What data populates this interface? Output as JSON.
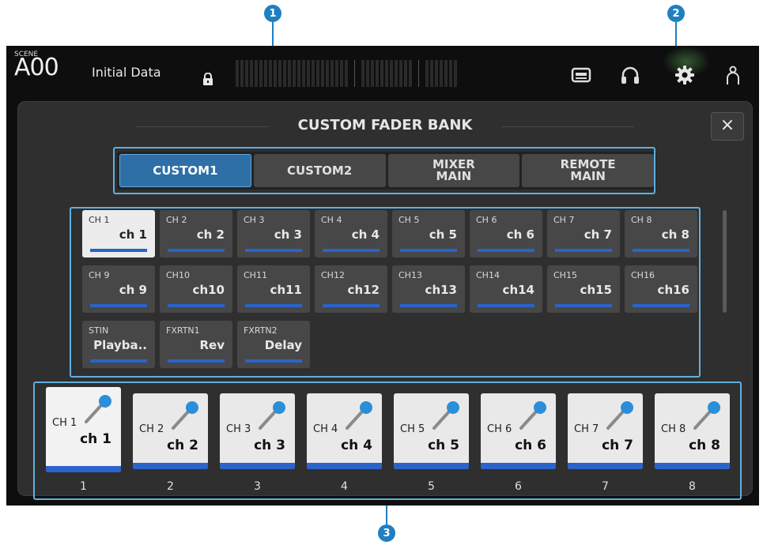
{
  "callouts": [
    "1",
    "2",
    "3"
  ],
  "topbar": {
    "scene_label": "SCENE",
    "scene_number": "A00",
    "scene_title": "Initial Data"
  },
  "panel": {
    "title": "CUSTOM FADER BANK",
    "close_label": "×"
  },
  "tabs": [
    {
      "label": "CUSTOM1",
      "active": true
    },
    {
      "label": "CUSTOM2",
      "active": false
    },
    {
      "label": "MIXER\nMAIN",
      "active": false
    },
    {
      "label": "REMOTE\nMAIN",
      "active": false
    }
  ],
  "channels": [
    {
      "label": "CH 1",
      "name": "ch 1",
      "selected": true
    },
    {
      "label": "CH 2",
      "name": "ch 2"
    },
    {
      "label": "CH 3",
      "name": "ch 3"
    },
    {
      "label": "CH 4",
      "name": "ch 4"
    },
    {
      "label": "CH 5",
      "name": "ch 5"
    },
    {
      "label": "CH 6",
      "name": "ch 6"
    },
    {
      "label": "CH 7",
      "name": "ch 7"
    },
    {
      "label": "CH 8",
      "name": "ch 8"
    },
    {
      "label": "CH 9",
      "name": "ch 9"
    },
    {
      "label": "CH10",
      "name": "ch10"
    },
    {
      "label": "CH11",
      "name": "ch11"
    },
    {
      "label": "CH12",
      "name": "ch12"
    },
    {
      "label": "CH13",
      "name": "ch13"
    },
    {
      "label": "CH14",
      "name": "ch14"
    },
    {
      "label": "CH15",
      "name": "ch15"
    },
    {
      "label": "CH16",
      "name": "ch16"
    },
    {
      "label": "STIN",
      "name": "Playba.."
    },
    {
      "label": "FXRTN1",
      "name": "Rev"
    },
    {
      "label": "FXRTN2",
      "name": "Delay"
    }
  ],
  "faders": [
    {
      "label": "CH 1",
      "name": "ch 1",
      "number": "1",
      "icon": "microphone-icon"
    },
    {
      "label": "CH 2",
      "name": "ch 2",
      "number": "2",
      "icon": "microphone-icon"
    },
    {
      "label": "CH 3",
      "name": "ch 3",
      "number": "3",
      "icon": "microphone-icon"
    },
    {
      "label": "CH 4",
      "name": "ch 4",
      "number": "4",
      "icon": "microphone-icon"
    },
    {
      "label": "CH 5",
      "name": "ch 5",
      "number": "5",
      "icon": "microphone-icon"
    },
    {
      "label": "CH 6",
      "name": "ch 6",
      "number": "6",
      "icon": "microphone-icon"
    },
    {
      "label": "CH 7",
      "name": "ch 7",
      "number": "7",
      "icon": "microphone-icon"
    },
    {
      "label": "CH 8",
      "name": "ch 8",
      "number": "8",
      "icon": "microphone-icon"
    }
  ],
  "colors": {
    "accent": "#2d6fa6",
    "bar_blue": "#2a63c9",
    "callout": "#1f7fc0"
  }
}
